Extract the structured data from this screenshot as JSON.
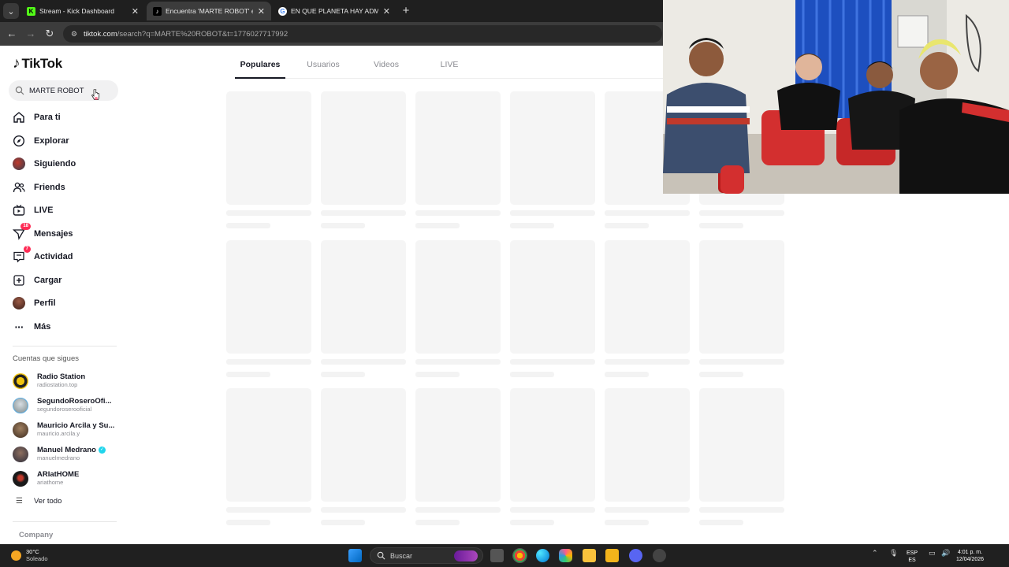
{
  "browser": {
    "tabs": [
      {
        "title": "Stream - Kick Dashboard",
        "icon": "kick-icon",
        "active": false
      },
      {
        "title": "Encuentra 'MARTE ROBOT' en TikTok",
        "icon": "tiktok-icon",
        "active": true
      },
      {
        "title": "EN QUE PLANETA HAY ADMOS...",
        "icon": "google-icon",
        "active": false
      }
    ],
    "url_host": "tiktok.com",
    "url_path": "/search?q=MARTE%20ROBOT&t=1776027717992"
  },
  "tiktok": {
    "logo_text": "TikTok",
    "search_value": "MARTE ROBOT",
    "nav": [
      {
        "label": "Para ti",
        "icon": "home-icon"
      },
      {
        "label": "Explorar",
        "icon": "compass-icon"
      },
      {
        "label": "Siguiendo",
        "icon": "following-avatar-icon"
      },
      {
        "label": "Friends",
        "icon": "friends-icon"
      },
      {
        "label": "LIVE",
        "icon": "live-tv-icon"
      },
      {
        "label": "Mensajes",
        "icon": "paper-plane-icon",
        "badge": "18"
      },
      {
        "label": "Actividad",
        "icon": "activity-icon",
        "badge": "7"
      },
      {
        "label": "Cargar",
        "icon": "upload-icon"
      },
      {
        "label": "Perfil",
        "icon": "profile-avatar-icon"
      },
      {
        "label": "Más",
        "icon": "more-dots-icon"
      }
    ],
    "following_title": "Cuentas que sigues",
    "following": [
      {
        "name": "Radio Station",
        "handle": "radiostation.top",
        "verified": false
      },
      {
        "name": "SegundoRoseroOfi...",
        "handle": "segundoroserooficial",
        "verified": false
      },
      {
        "name": "Mauricio Arcila y Su...",
        "handle": "mauricio.arcila.y",
        "verified": false
      },
      {
        "name": "Manuel Medrano",
        "handle": "manuelmedrano",
        "verified": true
      },
      {
        "name": "ARIatHOME",
        "handle": "ariathome",
        "verified": false
      }
    ],
    "see_all": "Ver todo",
    "company": "Company",
    "search_tabs": [
      "Populares",
      "Usuarios",
      "Videos",
      "LIVE"
    ]
  },
  "taskbar": {
    "weather_temp": "30°C",
    "weather_desc": "Soleado",
    "search_placeholder": "Buscar",
    "lang_top": "ESP",
    "lang_bottom": "ES",
    "time": "4:01 p. m.",
    "date": "12/04/2026"
  },
  "colors": {
    "accent": "#fe2c55",
    "verified": "#20d5ec",
    "chrome_dark": "#1f1f1f",
    "skeleton": "#f5f5f5"
  }
}
